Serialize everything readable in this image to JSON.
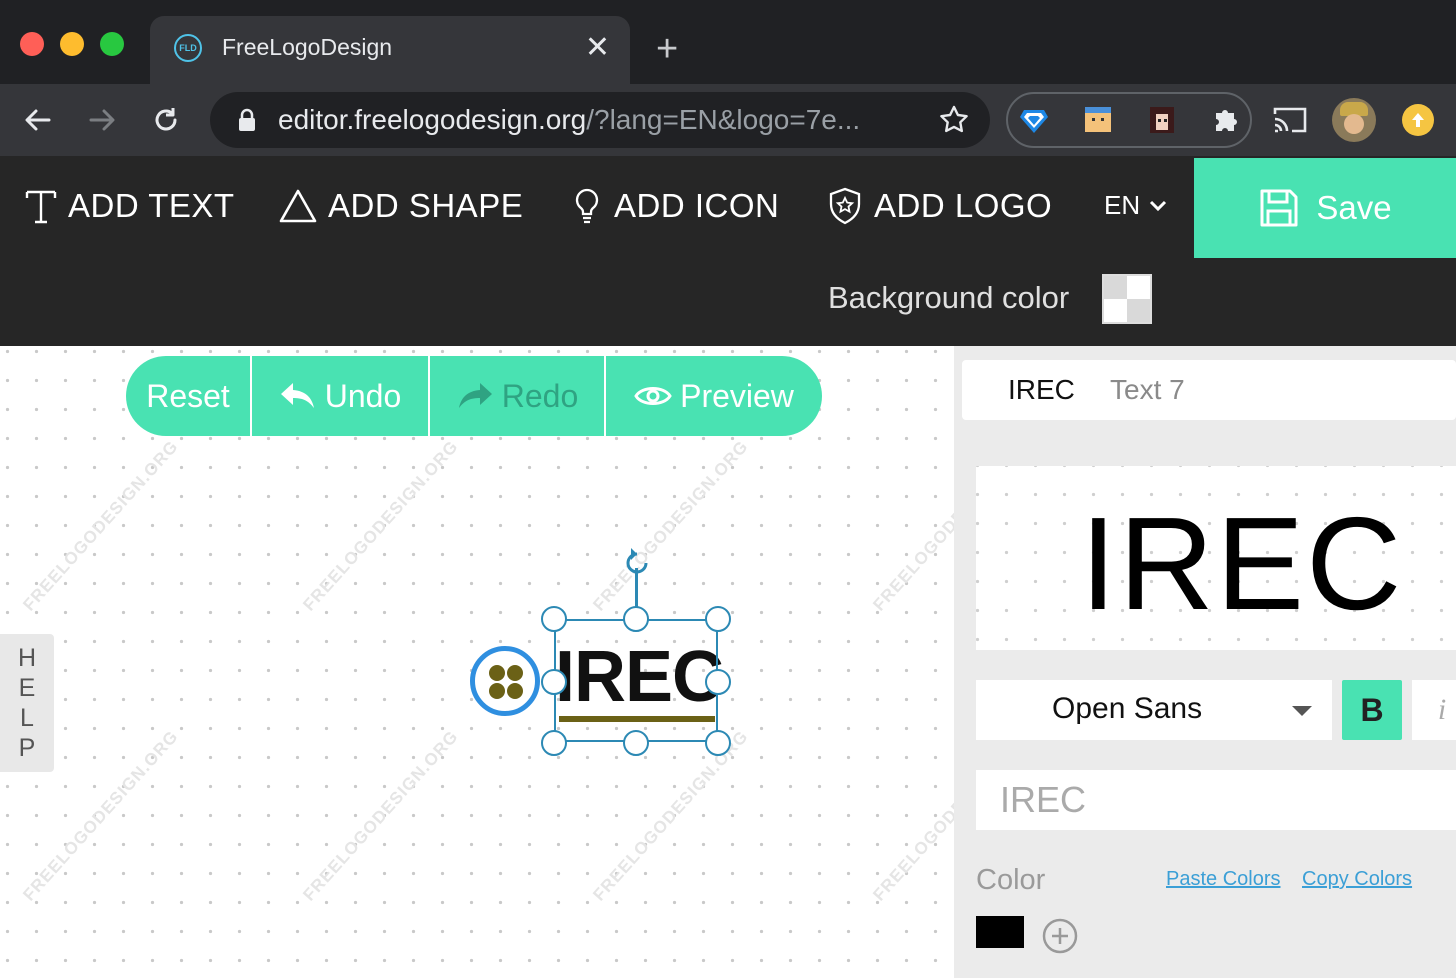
{
  "browser": {
    "tab_title": "FreeLogoDesign",
    "tab_favicon_text": "FLD",
    "tab_close": "✕",
    "new_tab": "+",
    "url_host": "editor.freelogodesign.org",
    "url_rest": "/?lang=EN&logo=7e..."
  },
  "menu": {
    "add_text": "ADD TEXT",
    "add_shape": "ADD SHAPE",
    "add_icon": "ADD ICON",
    "add_logo": "ADD LOGO",
    "language": "EN",
    "save": "Save",
    "background_color_label": "Background color"
  },
  "actions": {
    "reset": "Reset",
    "undo": "Undo",
    "redo": "Redo",
    "preview": "Preview"
  },
  "canvas": {
    "help_letters": [
      "H",
      "E",
      "L",
      "P"
    ],
    "watermark": "FREELOGODESIGN.ORG",
    "logo_text": "IREC",
    "icon_color": "#6b6116",
    "underline_color": "#6b6116",
    "selection_color": "#2c89b4"
  },
  "panel": {
    "layer_name": "IREC",
    "layer_sub": "Text 7",
    "preview_text": "IREC",
    "font_family": "Open Sans",
    "bold_label": "B",
    "italic_label": "i",
    "text_input_placeholder": "IREC",
    "color_label": "Color",
    "paste_colors": "Paste Colors",
    "copy_colors": "Copy Colors",
    "current_color": "#000000"
  },
  "colors": {
    "accent": "#49e2b2",
    "toolbar_bg": "#262626"
  }
}
